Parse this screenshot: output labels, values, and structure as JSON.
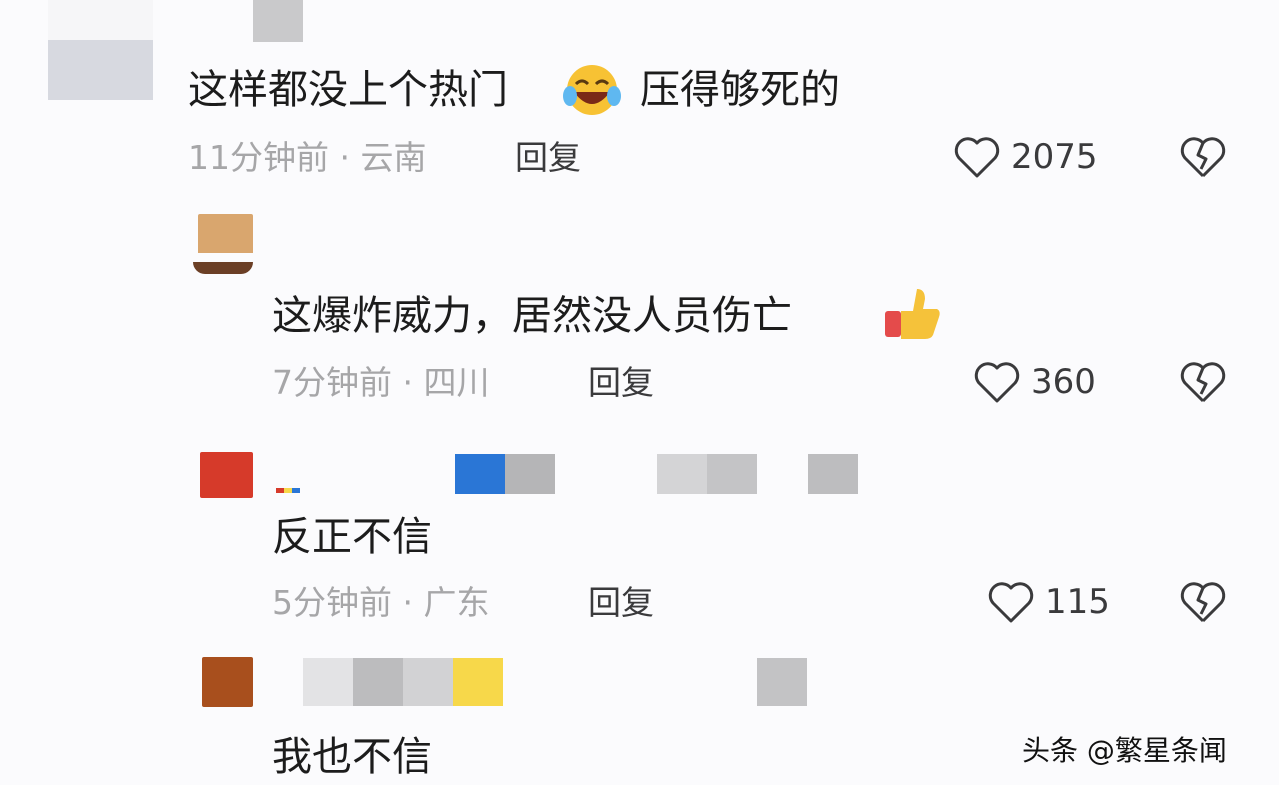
{
  "comments": [
    {
      "text": "这样都没上个热门",
      "text2": "压得够死的",
      "time": "11分钟前 · 云南",
      "reply": "回复",
      "likes": "2075"
    },
    {
      "text": "这爆炸威力，居然没人员伤亡",
      "time": "7分钟前 · 四川",
      "reply": "回复",
      "likes": "360"
    },
    {
      "text": "反正不信",
      "time": "5分钟前 · 广东",
      "reply": "回复",
      "likes": "115"
    },
    {
      "text": "我也不信"
    }
  ],
  "watermark": "头条 @繁星条闻",
  "colors": {
    "accent_red": "#d63a2a",
    "accent_blue": "#2a76d6",
    "accent_yellow": "#f7d84a",
    "accent_brown": "#a84f1d",
    "meta_gray": "#a6a6a8"
  }
}
